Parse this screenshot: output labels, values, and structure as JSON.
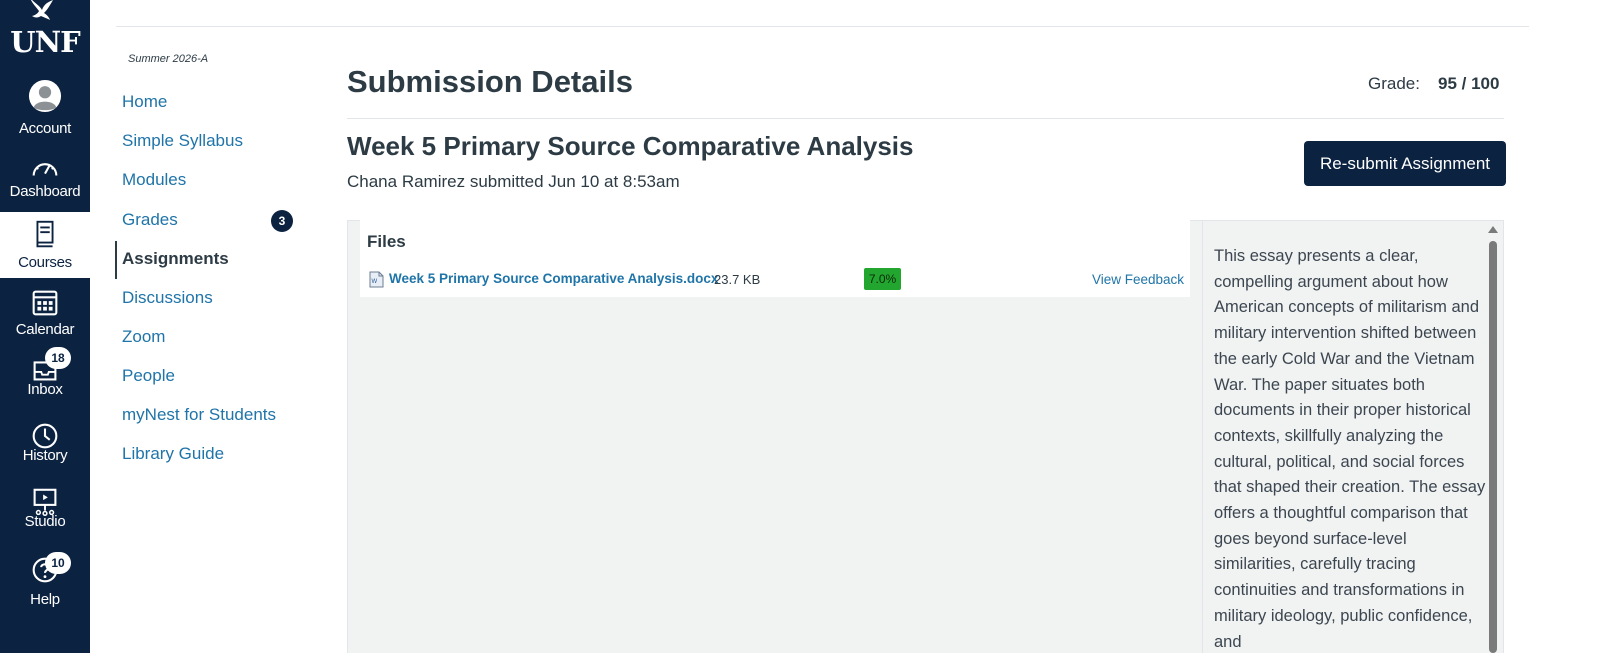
{
  "global_nav": {
    "logo_text": "UNF",
    "items": [
      {
        "label": "Account",
        "icon": "account-icon"
      },
      {
        "label": "Dashboard",
        "icon": "dashboard-icon"
      },
      {
        "label": "Courses",
        "icon": "courses-icon",
        "active": true
      },
      {
        "label": "Calendar",
        "icon": "calendar-icon"
      },
      {
        "label": "Inbox",
        "icon": "inbox-icon",
        "badge": "18"
      },
      {
        "label": "History",
        "icon": "history-icon"
      },
      {
        "label": "Studio",
        "icon": "studio-icon"
      },
      {
        "label": "Help",
        "icon": "help-icon",
        "badge": "10"
      }
    ]
  },
  "course_nav": {
    "term": "Summer 2026-A",
    "items": [
      {
        "label": "Home"
      },
      {
        "label": "Simple Syllabus"
      },
      {
        "label": "Modules"
      },
      {
        "label": "Grades",
        "badge": "3"
      },
      {
        "label": "Assignments",
        "active": true
      },
      {
        "label": "Discussions"
      },
      {
        "label": "Zoom"
      },
      {
        "label": "People"
      },
      {
        "label": "myNest for Students"
      },
      {
        "label": "Library Guide"
      }
    ]
  },
  "main": {
    "title": "Submission Details",
    "grade_label": "Grade:",
    "grade_value": "95 / 100",
    "assignment_title": "Week 5 Primary Source Comparative Analysis",
    "submitted_text": "Chana Ramirez submitted Jun 10 at 8:53am",
    "resubmit_label": "Re-submit Assignment",
    "files": {
      "heading": "Files",
      "items": [
        {
          "name": "Week 5 Primary Source Comparative Analysis.docx",
          "size": "23.7 KB",
          "similarity": "7.0%",
          "feedback_label": "View Feedback"
        }
      ]
    },
    "comment": "This essay presents a clear, compelling argument about how American concepts of militarism and military intervention shifted between the early Cold War and the Vietnam War. The paper situates both documents in their proper historical contexts, skillfully analyzing the cultural, political, and social forces that shaped their creation. The essay offers a thoughtful comparison that goes beyond surface-level similarities, carefully tracing continuities and transformations in military ideology, public confidence, and"
  },
  "colors": {
    "nav_bg": "#0b2240",
    "link": "#1f74a8",
    "similarity_badge": "#23a62f",
    "panel_bg": "#f1f2f2"
  }
}
